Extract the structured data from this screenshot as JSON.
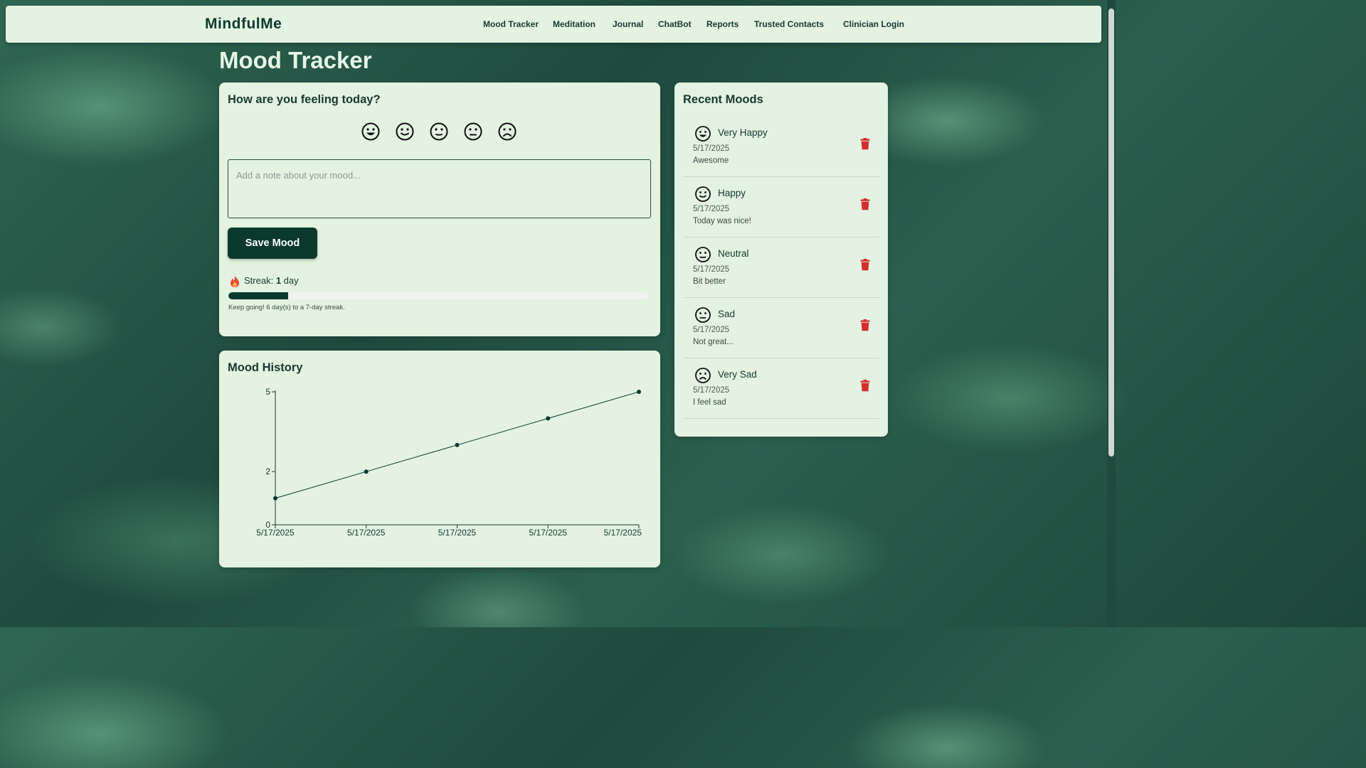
{
  "app": {
    "brand": "MindfulMe"
  },
  "nav": {
    "items": [
      {
        "label": "Mood Tracker"
      },
      {
        "label": "Meditation"
      },
      {
        "label": "Journal"
      },
      {
        "label": "ChatBot"
      },
      {
        "label": "Reports"
      },
      {
        "label": "Trusted Contacts"
      },
      {
        "label": "Clinician Login"
      }
    ]
  },
  "page": {
    "title": "Mood Tracker"
  },
  "checkin": {
    "heading": "How are you feeling today?",
    "moods": [
      "very-happy-icon",
      "happy-icon",
      "neutral-icon",
      "sad-icon",
      "very-sad-icon"
    ],
    "note_placeholder": "Add a note about your mood...",
    "note_value": "",
    "save_label": "Save Mood",
    "streak_label": "Streak:",
    "streak_count": "1",
    "streak_unit": "day",
    "streak_progress": 0.1429,
    "streak_message": "Keep going! 6 day(s) to a 7-day streak."
  },
  "history": {
    "heading": "Mood History"
  },
  "recent": {
    "heading": "Recent Moods",
    "items": [
      {
        "icon": "very-happy-icon",
        "label": "Very Happy",
        "date": "5/17/2025",
        "note": "Awesome"
      },
      {
        "icon": "happy-icon",
        "label": "Happy",
        "date": "5/17/2025",
        "note": "Today was nice!"
      },
      {
        "icon": "neutral-icon",
        "label": "Neutral",
        "date": "5/17/2025",
        "note": "Bit better"
      },
      {
        "icon": "sad-icon",
        "label": "Sad",
        "date": "5/17/2025",
        "note": "Not great..."
      },
      {
        "icon": "very-sad-icon",
        "label": "Very Sad",
        "date": "5/17/2025",
        "note": "I feel sad"
      }
    ]
  },
  "colors": {
    "accent": "#0b3a2d",
    "card": "#e3f2e1",
    "delete": "#d32f2f",
    "line": "#0b3a2d"
  },
  "chart_data": {
    "type": "line",
    "categories": [
      "5/17/2025",
      "5/17/2025",
      "5/17/2025",
      "5/17/2025",
      "5/17/2025"
    ],
    "series": [
      {
        "values": [
          1,
          2,
          3,
          4,
          5
        ]
      }
    ],
    "ylim": [
      0,
      5
    ],
    "yticks": [
      0,
      2,
      5
    ],
    "xlabel": "",
    "ylabel": "",
    "grid": false
  }
}
